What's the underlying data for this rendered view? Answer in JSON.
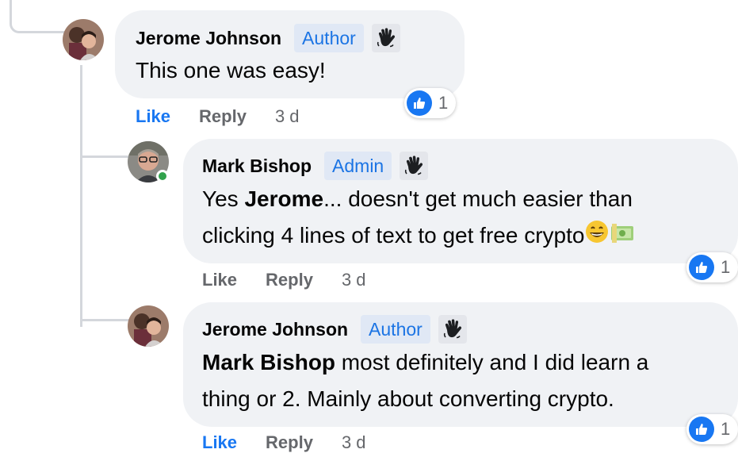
{
  "comments": [
    {
      "name": "Jerome Johnson",
      "role": "Author",
      "badge_icon": "waving-hand-icon",
      "text": "This one was easy!",
      "reaction_icon": "thumbs-up-reaction-icon",
      "reaction_count": "1",
      "actions": {
        "like": "Like",
        "reply": "Reply",
        "time": "3 d"
      }
    },
    {
      "name": "Mark Bishop",
      "role": "Admin",
      "badge_icon": "waving-hand-icon",
      "text_line1_prefix": "Yes ",
      "text_mention": "Jerome",
      "text_line1_suffix": "... doesn't get much easier than",
      "text_line2": "clicking 4 lines of text to get free crypto",
      "emojis": [
        "grinning-face-emoji",
        "money-bills-emoji"
      ],
      "online": true,
      "reaction_icon": "thumbs-up-reaction-icon",
      "reaction_count": "1",
      "actions": {
        "like": "Like",
        "reply": "Reply",
        "time": "3 d"
      }
    },
    {
      "name": "Jerome Johnson",
      "role": "Author",
      "badge_icon": "waving-hand-icon",
      "text_mention": "Mark Bishop",
      "text_line1_suffix": " most definitely and I did learn a",
      "text_line2": "thing or 2. Mainly about converting crypto.",
      "reaction_icon": "thumbs-up-reaction-icon",
      "reaction_count": "1",
      "actions": {
        "like": "Like",
        "reply": "Reply",
        "time": "3 d"
      }
    }
  ],
  "colors": {
    "bubble": "#f0f2f5",
    "link_blue": "#1877f2",
    "role_text": "#1b74e4",
    "muted": "#65676b",
    "online": "#31a24c"
  }
}
